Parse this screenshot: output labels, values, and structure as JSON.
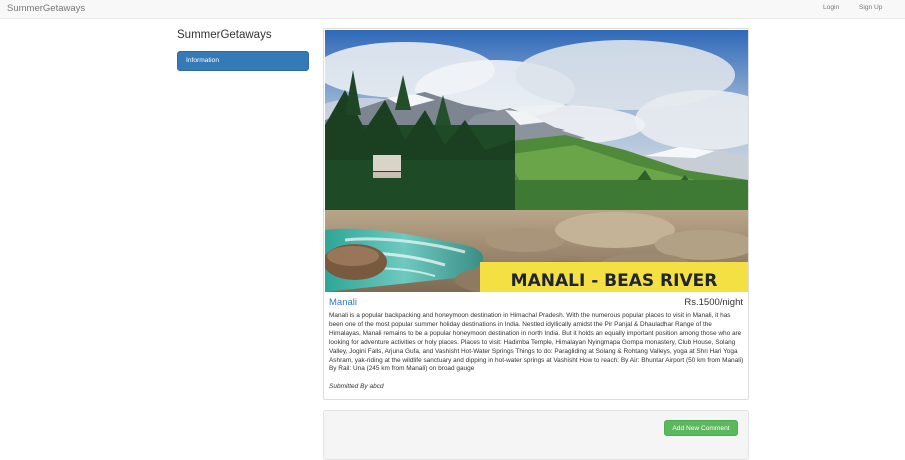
{
  "navbar": {
    "brand": "SummerGetaways",
    "login_label": "Login",
    "signup_label": "Sign Up"
  },
  "sidebar": {
    "title": "SummerGetaways",
    "items": [
      {
        "label": "Information",
        "active": true
      }
    ]
  },
  "listing": {
    "image_caption": "MANALI - BEAS RIVER",
    "name": "Manali",
    "price": "Rs.1500/night",
    "description": "Manali is a popular backpacking and honeymoon destination in Himachal Pradesh. With the numerous popular places to visit in Manali, it has been one of the most popular summer holiday destinations in India. Nestled idyllically amidst the Pir Panjal & Dhauladhar Range of the Himalayas, Manali remains to be a popular honeymoon destination in north India. But it holds an equally important position among those who are looking for adventure activities or holy places. Places to visit: Hadimba Temple, Himalayan Nyingmapa Gompa monastery, Club House, Solang Valley, Jogini Falls, Arjuna Gufa, and Vashisht Hot-Water Springs Things to do: Paragliding at Solang & Rohtang Valleys, yoga at Shri Hari Yoga Ashram, yak-riding at the wildlife sanctuary and dipping in hot-water springs at Vashisht How to reach: By Air: Bhuntar Airport (50 km from Manali) By Rail: Una (245 km from Manali) on broad gauge",
    "submitted_by": "Submitted By abcd"
  },
  "comments": {
    "add_label": "Add New Comment"
  },
  "colors": {
    "primary": "#337ab7",
    "success": "#5cb85c",
    "caption_banner": "#f4e043"
  }
}
